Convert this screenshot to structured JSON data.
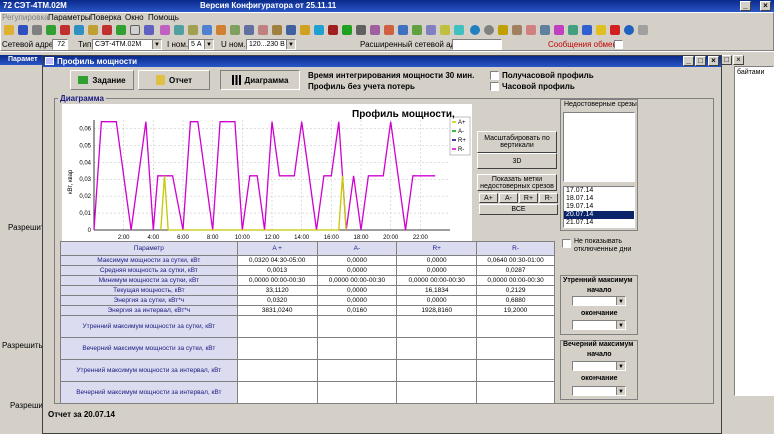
{
  "app": {
    "title_left": "72  СЭТ-4ТМ.02М",
    "title_center": "Версия Конфигуратора  от 25.11.11",
    "menu": [
      "Регулировка",
      "Параметры",
      "Поверка",
      "Окно",
      "Помощь"
    ]
  },
  "params_bar": {
    "net_addr_label": "Сетевой адрес",
    "net_addr_value": "72",
    "type_label": "Тип",
    "type_value": "СЭТ-4ТМ.02М",
    "inom_label": "I ном.",
    "inom_value": "5 А",
    "unom_label": "U ном.",
    "unom_value": "120...230 В",
    "ext_addr_label": "Расширенный сетевой адрес",
    "messages_label": "Сообщения обмена"
  },
  "background": {
    "params_tab": "Парамет",
    "side_labels": [
      "Разрешить и",
      "Разрешить сс",
      "Разрешить"
    ],
    "right_header": "байтами"
  },
  "dialog": {
    "title": "Профиль мощности",
    "tabs": {
      "task": "Задание",
      "report": "Отчет",
      "diagram": "Диаграмма"
    },
    "info_line1": "Время интегрирования мощности 30 мин.",
    "info_line2": "Профиль без учета потерь",
    "half_hour_label": "Получасовой профиль",
    "hour_label": "Часовой профиль",
    "group_label": "Диаграмма",
    "status": "Отчет за 20.07.14"
  },
  "controls": {
    "scale_btn": "Масштабировать по вертикали",
    "btn_3d": "3D",
    "show_marks_btn": "Показать метки недостоверных срезов",
    "channel_btns": [
      "A+",
      "A-",
      "R+",
      "R-"
    ],
    "all_btn": "ВСЕ",
    "unreliable_label": "Недостоверные срезы",
    "dates": [
      "17.07.14",
      "18.07.14",
      "19.07.14",
      "20.07.14",
      "21.07.14"
    ],
    "selected_date": "20.07.14",
    "no_show_label": "Не показывать отключенные дни",
    "morning_max_label": "Утренний максимум",
    "evening_max_label": "Вечерний максимум",
    "start_label": "начало",
    "end_label": "окончание"
  },
  "table": {
    "headers": [
      "Параметр",
      "A +",
      "A-",
      "R+",
      "R-"
    ],
    "rows": [
      [
        "Максимум мощности за сутки, кВт",
        "0,0320 04:30-05:00",
        "0,0000",
        "0,0000",
        "0,0640 00:30-01:00"
      ],
      [
        "Средняя мощность за сутки, кВт",
        "0,0013",
        "0,0000",
        "0,0000",
        "0,0287"
      ],
      [
        "Минимум мощности за сутки, кВт",
        "0,0000 00:00-00:30",
        "0,0000 00:00-00:30",
        "0,0000 00:00-00:30",
        "0,0000 00:00-00:30"
      ],
      [
        "Текущая мощность, кВт",
        "33,1120",
        "0,0000",
        "16,1834",
        "0,2129"
      ],
      [
        "Энергия за сутки, кВт*ч",
        "0,0320",
        "0,0000",
        "0,0000",
        "0,6880"
      ],
      [
        "Энергия за интервал, кВт*ч",
        "3831,0240",
        "0,0160",
        "1928,8160",
        "19,2000"
      ]
    ],
    "tall_rows": [
      "Утренний максимум мощности за сутки, кВт",
      "Вечерний максимум мощности за сутки, кВт",
      "Утренний максимум мощности за интервал, кВт",
      "Вечерний максимум мощности за интервал, кВт"
    ]
  },
  "chart_data": {
    "type": "line",
    "title": "Профиль мощности,",
    "ylabel": "кВт, квар",
    "xlabel": "",
    "ylim": [
      0,
      0.065
    ],
    "yticks": [
      "0",
      "0,01",
      "0,02",
      "0,03",
      "0,04",
      "0,05",
      "0,06"
    ],
    "xticks": [
      "2:00",
      "4:00",
      "6:00",
      "8:00",
      "10:00",
      "12:00",
      "14:00",
      "16:00",
      "18:00",
      "20:00",
      "22:00"
    ],
    "xlim": [
      0,
      24
    ],
    "legend": "top-right",
    "series": [
      {
        "name": "A+",
        "color": "#c8c800",
        "points": [
          [
            4.5,
            0
          ],
          [
            4.75,
            0.032
          ],
          [
            5.0,
            0
          ],
          [
            16.5,
            0
          ],
          [
            16.75,
            0.032
          ],
          [
            17.0,
            0
          ]
        ]
      },
      {
        "name": "A-",
        "color": "#00a000",
        "points": []
      },
      {
        "name": "R+",
        "color": "#000080",
        "points": []
      },
      {
        "name": "R-",
        "color": "#d000d0",
        "points": [
          [
            0,
            0
          ],
          [
            0.5,
            0.064
          ],
          [
            1.5,
            0.064
          ],
          [
            2.5,
            0
          ],
          [
            3.5,
            0.064
          ],
          [
            4.0,
            0
          ],
          [
            4.3,
            0.032
          ],
          [
            5.3,
            0.032
          ],
          [
            6.0,
            0
          ],
          [
            6.5,
            0.064
          ],
          [
            7.0,
            0.064
          ],
          [
            8.0,
            0
          ],
          [
            8.5,
            0.064
          ],
          [
            9.5,
            0.064
          ],
          [
            10.0,
            0
          ],
          [
            10.5,
            0.032
          ],
          [
            11.0,
            0.032
          ],
          [
            11.5,
            0
          ],
          [
            12.0,
            0.064
          ],
          [
            12.5,
            0.032
          ],
          [
            13.5,
            0.032
          ],
          [
            14.0,
            0.064
          ],
          [
            15.0,
            0
          ],
          [
            15.5,
            0.032
          ],
          [
            16.0,
            0.032
          ],
          [
            16.5,
            0.064
          ],
          [
            17.0,
            0
          ],
          [
            17.5,
            0.032
          ],
          [
            18.0,
            0
          ],
          [
            18.5,
            0.032
          ],
          [
            19.5,
            0.032
          ],
          [
            20.0,
            0.064
          ],
          [
            21.0,
            0
          ],
          [
            21.5,
            0.032
          ],
          [
            23.0,
            0.032
          ]
        ]
      }
    ]
  }
}
